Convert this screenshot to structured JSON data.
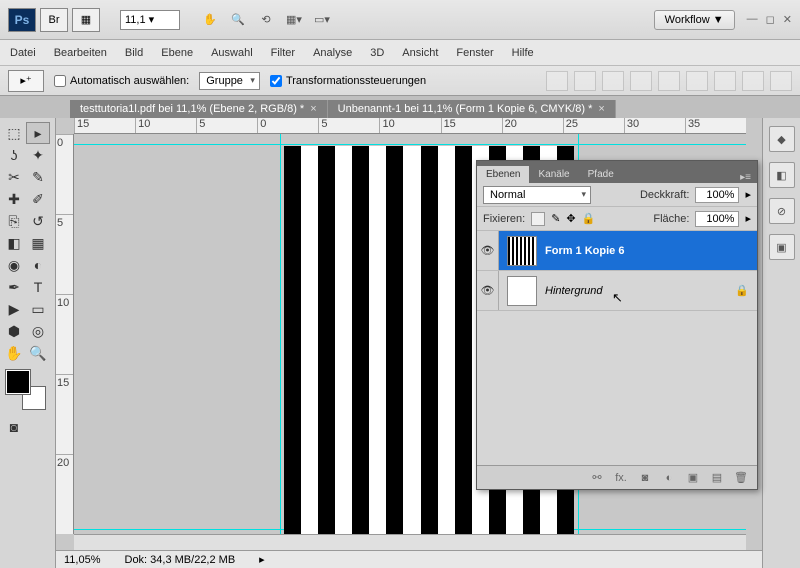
{
  "topbar": {
    "zoom": "11,1 ▾",
    "workflow": "Workflow ▼"
  },
  "menu": [
    "Datei",
    "Bearbeiten",
    "Bild",
    "Ebene",
    "Auswahl",
    "Filter",
    "Analyse",
    "3D",
    "Ansicht",
    "Fenster",
    "Hilfe"
  ],
  "optbar": {
    "auto_sel": "Automatisch auswählen:",
    "group": "Gruppe",
    "transform": "Transformationssteuerungen"
  },
  "tabs": [
    "testtutoria1l.pdf bei 11,1% (Ebene 2, RGB/8) *",
    "Unbenannt-1 bei 11,1% (Form 1 Kopie 6, CMYK/8) *"
  ],
  "ruler_h": [
    "15",
    "10",
    "5",
    "0",
    "5",
    "10",
    "15",
    "20",
    "25",
    "30",
    "35"
  ],
  "ruler_v": [
    "0",
    "5",
    "10",
    "15",
    "20"
  ],
  "status": {
    "zoom": "11,05%",
    "doc": "Dok: 34,3 MB/22,2 MB"
  },
  "layers": {
    "tabs": [
      "Ebenen",
      "Kanäle",
      "Pfade"
    ],
    "mode": "Normal",
    "opacity_lbl": "Deckkraft:",
    "opacity_val": "100%",
    "lock_lbl": "Fixieren:",
    "fill_lbl": "Fläche:",
    "fill_val": "100%",
    "items": [
      {
        "name": "Form 1 Kopie 6"
      },
      {
        "name": "Hintergrund"
      }
    ]
  }
}
